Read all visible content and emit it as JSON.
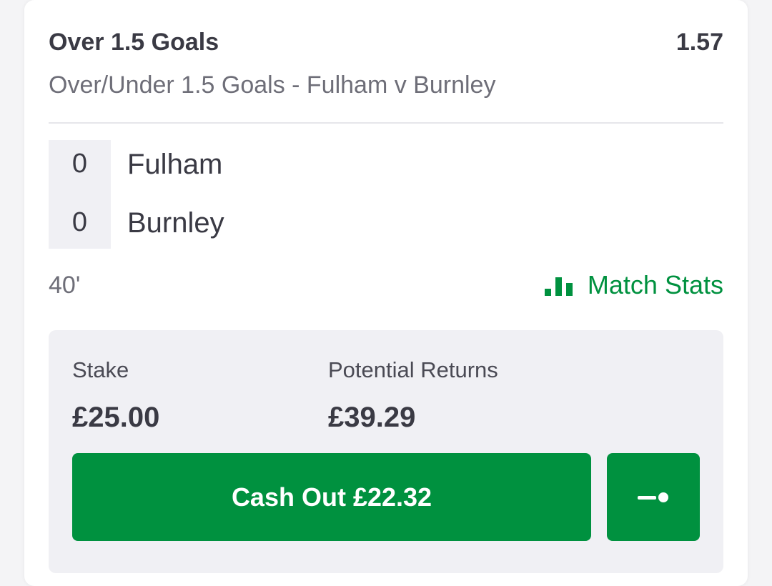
{
  "bet": {
    "selection": "Over 1.5 Goals",
    "odds": "1.57",
    "market": "Over/Under 1.5 Goals - Fulham v Burnley"
  },
  "scoreboard": {
    "teams": [
      {
        "score": "0",
        "name": "Fulham"
      },
      {
        "score": "0",
        "name": "Burnley"
      }
    ],
    "match_time": "40'"
  },
  "match_stats": {
    "label": "Match Stats",
    "icon": "bar-chart-icon"
  },
  "stake": {
    "label": "Stake",
    "value": "£25.00"
  },
  "returns": {
    "label": "Potential Returns",
    "value": "£39.29"
  },
  "actions": {
    "cash_out_label": "Cash Out £22.32",
    "partial_icon": "slider-toggle-icon"
  },
  "colors": {
    "accent_green": "#00913f",
    "text_dark": "#3a3a44",
    "text_muted": "#6e6e78",
    "panel_bg": "#f0f0f4"
  }
}
